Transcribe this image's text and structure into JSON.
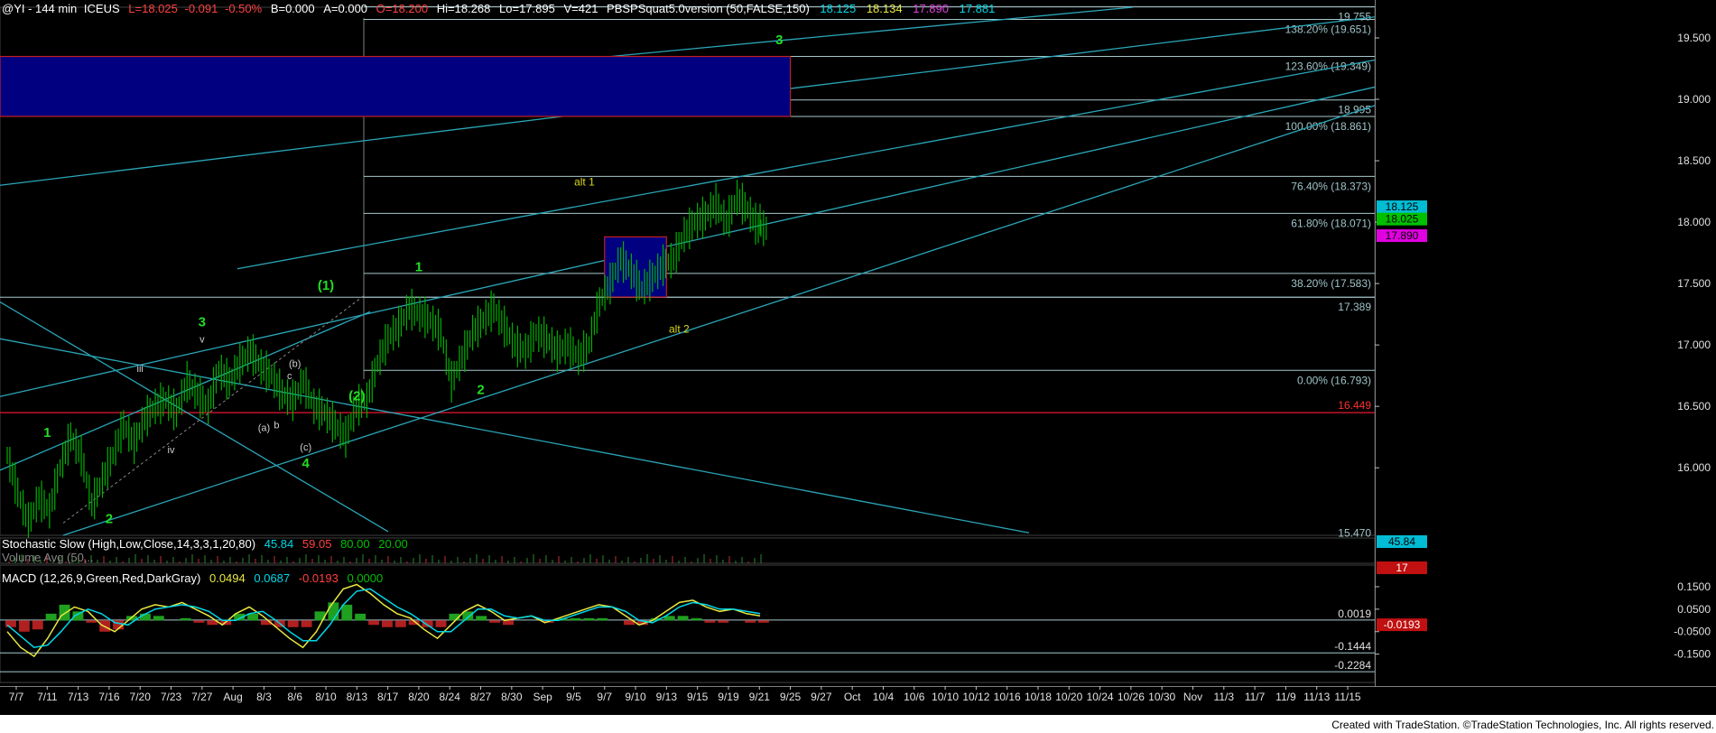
{
  "header": {
    "symbol": "@YI - 144 min",
    "exchange": "ICEUS",
    "last": "L=18.025",
    "change": "-0.091",
    "pct": "-0.50%",
    "bid": "B=0.000",
    "ask": "A=0.000",
    "open": "O=18.200",
    "hi": "Hi=18.268",
    "lo": "Lo=17.895",
    "vol": "V=421",
    "study": "PBSPSquat5.0version (50,FALSE,150)",
    "v1": "18.125",
    "v2": "18.134",
    "v3": "17.890",
    "v4": "17.881"
  },
  "indicators": {
    "stoch_label": "Stochastic Slow (High,Low,Close,14,3,3,1,20,80)",
    "stoch_v1": "45.84",
    "stoch_v2": "59.05",
    "stoch_v3": "80.00",
    "stoch_v4": "20.00",
    "volume_label": "Volume Avg (50,..",
    "macd_label": "MACD (12,26,9,Green,Red,DarkGray)",
    "macd_v1": "0.0494",
    "macd_v2": "0.0687",
    "macd_v3": "-0.0193",
    "macd_v4": "0.0000"
  },
  "footer": {
    "text": "Created with TradeStation. ©TradeStation Technologies, Inc. All rights reserved."
  },
  "colors": {
    "bars": "#00b000",
    "channel": "#2aa6b8",
    "hline": "#a6c8cc",
    "redline": "#c0142a",
    "box": "#000080",
    "wave_green": "#22dd22",
    "wave_yellow": "#d8d81a"
  },
  "chart_data": {
    "type": "line",
    "title": "",
    "price_axis": {
      "ylim": [
        15.45,
        19.75
      ],
      "ticks": [
        {
          "v": 19.5,
          "label": "19.500"
        },
        {
          "v": 19.0,
          "label": "19.000"
        },
        {
          "v": 18.5,
          "label": "18.500"
        },
        {
          "v": 18.0,
          "label": "18.000"
        },
        {
          "v": 17.5,
          "label": "17.500"
        },
        {
          "v": 17.0,
          "label": "17.000"
        },
        {
          "v": 16.5,
          "label": "16.500"
        },
        {
          "v": 16.0,
          "label": "16.000"
        }
      ]
    },
    "x_ticks": [
      "7/7",
      "7/11",
      "7/13",
      "7/16",
      "7/20",
      "7/23",
      "7/27",
      "Aug",
      "8/3",
      "8/6",
      "8/10",
      "8/13",
      "8/17",
      "8/20",
      "8/24",
      "8/27",
      "8/30",
      "Sep",
      "9/5",
      "9/7",
      "9/10",
      "9/13",
      "9/15",
      "9/19",
      "9/21",
      "9/25",
      "9/27",
      "Oct",
      "10/4",
      "10/6",
      "10/10",
      "10/12",
      "10/16",
      "10/18",
      "10/20",
      "10/24",
      "10/26",
      "10/30",
      "Nov",
      "11/3",
      "11/7",
      "11/9",
      "11/13",
      "11/15"
    ],
    "fib_levels": [
      {
        "v": 19.755,
        "label": "19.755"
      },
      {
        "v": 19.651,
        "label": "138.20% (19.651)"
      },
      {
        "v": 19.349,
        "label": "123.60% (19.349)"
      },
      {
        "v": 18.995,
        "label": "18.995"
      },
      {
        "v": 18.861,
        "label": "100.00% (18.861)"
      },
      {
        "v": 18.373,
        "label": "76.40% (18.373)"
      },
      {
        "v": 18.071,
        "label": "61.80% (18.071)"
      },
      {
        "v": 17.583,
        "label": "38.20% (17.583)"
      },
      {
        "v": 17.389,
        "label": "17.389"
      },
      {
        "v": 16.793,
        "label": "0.00% (16.793)"
      }
    ],
    "red_level": {
      "v": 16.449,
      "label": "16.449"
    },
    "low_label": {
      "v": 15.47,
      "label": "15.470"
    },
    "price_tags": [
      {
        "v": 18.125,
        "label": "18.125",
        "color": "#00bcd4"
      },
      {
        "v": 18.025,
        "label": "18.025",
        "color": "#00c000"
      },
      {
        "v": 17.89,
        "label": "17.890",
        "color": "#e000e0"
      }
    ],
    "target_boxes": [
      {
        "x1": "9/20",
        "x2": "9/25",
        "top": 19.349,
        "bottom": 18.861
      },
      {
        "x1": "9/7",
        "x2": "9/13",
        "top": 17.88,
        "bottom": 17.39
      }
    ],
    "wave_labels": [
      {
        "text": "1",
        "x": "7/11",
        "v": 16.25,
        "color": "green"
      },
      {
        "text": "2",
        "x": "7/16",
        "v": 15.55,
        "color": "green"
      },
      {
        "text": "3",
        "x": "7/27",
        "v": 17.15,
        "color": "green"
      },
      {
        "text": "4",
        "x": "8/6",
        "v": 16.0,
        "color": "green"
      },
      {
        "text": "(1)",
        "x": "8/10",
        "v": 17.45,
        "color": "green"
      },
      {
        "text": "(2)",
        "x": "8/13",
        "v": 16.55,
        "color": "green"
      },
      {
        "text": "1",
        "x": "8/20",
        "v": 17.6,
        "color": "green"
      },
      {
        "text": "2",
        "x": "8/27",
        "v": 16.6,
        "color": "green"
      },
      {
        "text": "3",
        "x": "9/21",
        "v": 19.45,
        "color": "green"
      },
      {
        "text": "alt 1",
        "x": "9/5",
        "v": 18.3,
        "color": "yellow"
      },
      {
        "text": "alt 2",
        "x": "9/13",
        "v": 17.1,
        "color": "yellow"
      },
      {
        "text": "iii",
        "x": "7/20",
        "v": 16.78,
        "color": "white"
      },
      {
        "text": "iv",
        "x": "7/23",
        "v": 16.12,
        "color": "white"
      },
      {
        "text": "v",
        "x": "7/27",
        "v": 17.02,
        "color": "white"
      },
      {
        "text": "(a)",
        "x": "8/3",
        "v": 16.3,
        "color": "white"
      },
      {
        "text": "b",
        "x": "8/3",
        "v": 16.32,
        "color": "white"
      },
      {
        "text": "(b)",
        "x": "8/6",
        "v": 16.82,
        "color": "white"
      },
      {
        "text": "c",
        "x": "8/6",
        "v": 16.72,
        "color": "white"
      },
      {
        "text": "(c)",
        "x": "8/6",
        "v": 16.14,
        "color": "white"
      }
    ],
    "series": [
      {
        "name": "@YI - 144 min",
        "values": [
          16.1,
          15.8,
          15.55,
          15.75,
          15.65,
          16.0,
          16.25,
          16.1,
          15.7,
          15.9,
          16.1,
          16.35,
          16.2,
          16.4,
          16.5,
          16.55,
          16.45,
          16.7,
          16.6,
          16.5,
          16.8,
          16.7,
          16.85,
          16.95,
          16.82,
          16.75,
          16.6,
          16.55,
          16.7,
          16.5,
          16.45,
          16.35,
          16.25,
          16.5,
          16.55,
          16.85,
          17.05,
          17.15,
          17.3,
          17.25,
          17.2,
          17.1,
          16.7,
          16.9,
          17.1,
          17.2,
          17.3,
          17.15,
          17.0,
          16.95,
          17.1,
          17.05,
          16.95,
          17.0,
          16.9,
          17.0,
          17.35,
          17.5,
          17.7,
          17.6,
          17.45,
          17.55,
          17.65,
          17.7,
          17.9,
          18.0,
          18.05,
          18.15,
          18.0,
          18.2,
          18.1,
          17.95
        ]
      }
    ],
    "stochastic": {
      "k": 45.84,
      "d": 59.05,
      "overbought": 80,
      "oversold": 20
    },
    "macd_axis": {
      "ticks": [
        {
          "v": 0.15,
          "label": "0.1500"
        },
        {
          "v": 0.05,
          "label": "0.0500"
        },
        {
          "v": -0.05,
          "label": "-0.0500"
        },
        {
          "v": -0.15,
          "label": "-0.1500"
        }
      ],
      "levels": [
        {
          "v": 0.0019,
          "label": "0.0019"
        },
        {
          "v": -0.1444,
          "label": "-0.1444"
        },
        {
          "v": -0.2284,
          "label": "-0.2284"
        }
      ],
      "tag": {
        "v": -0.0193,
        "label": "-0.0193"
      }
    },
    "macd": {
      "macd_values": [
        -0.05,
        -0.12,
        -0.16,
        -0.08,
        0.02,
        0.06,
        0.04,
        -0.02,
        -0.05,
        0.0,
        0.05,
        0.07,
        0.06,
        0.08,
        0.05,
        0.02,
        -0.02,
        0.03,
        0.06,
        0.02,
        -0.03,
        -0.08,
        -0.12,
        -0.05,
        0.06,
        0.14,
        0.16,
        0.12,
        0.07,
        0.03,
        0.01,
        -0.04,
        -0.08,
        -0.02,
        0.04,
        0.07,
        0.04,
        0.0,
        0.01,
        0.02,
        -0.01,
        0.01,
        0.03,
        0.05,
        0.07,
        0.06,
        0.02,
        -0.02,
        0.0,
        0.04,
        0.08,
        0.09,
        0.06,
        0.04,
        0.05,
        0.03,
        0.02
      ],
      "signal_values": [
        -0.02,
        -0.07,
        -0.12,
        -0.11,
        -0.05,
        0.02,
        0.05,
        0.03,
        -0.01,
        -0.02,
        0.02,
        0.05,
        0.06,
        0.07,
        0.06,
        0.04,
        0.0,
        0.0,
        0.03,
        0.04,
        0.0,
        -0.05,
        -0.09,
        -0.09,
        -0.02,
        0.07,
        0.13,
        0.14,
        0.1,
        0.06,
        0.03,
        -0.01,
        -0.05,
        -0.05,
        0.0,
        0.05,
        0.05,
        0.02,
        0.01,
        0.02,
        0.0,
        0.0,
        0.02,
        0.04,
        0.06,
        0.06,
        0.04,
        0.0,
        -0.01,
        0.02,
        0.06,
        0.08,
        0.07,
        0.05,
        0.05,
        0.04,
        0.03
      ]
    }
  }
}
